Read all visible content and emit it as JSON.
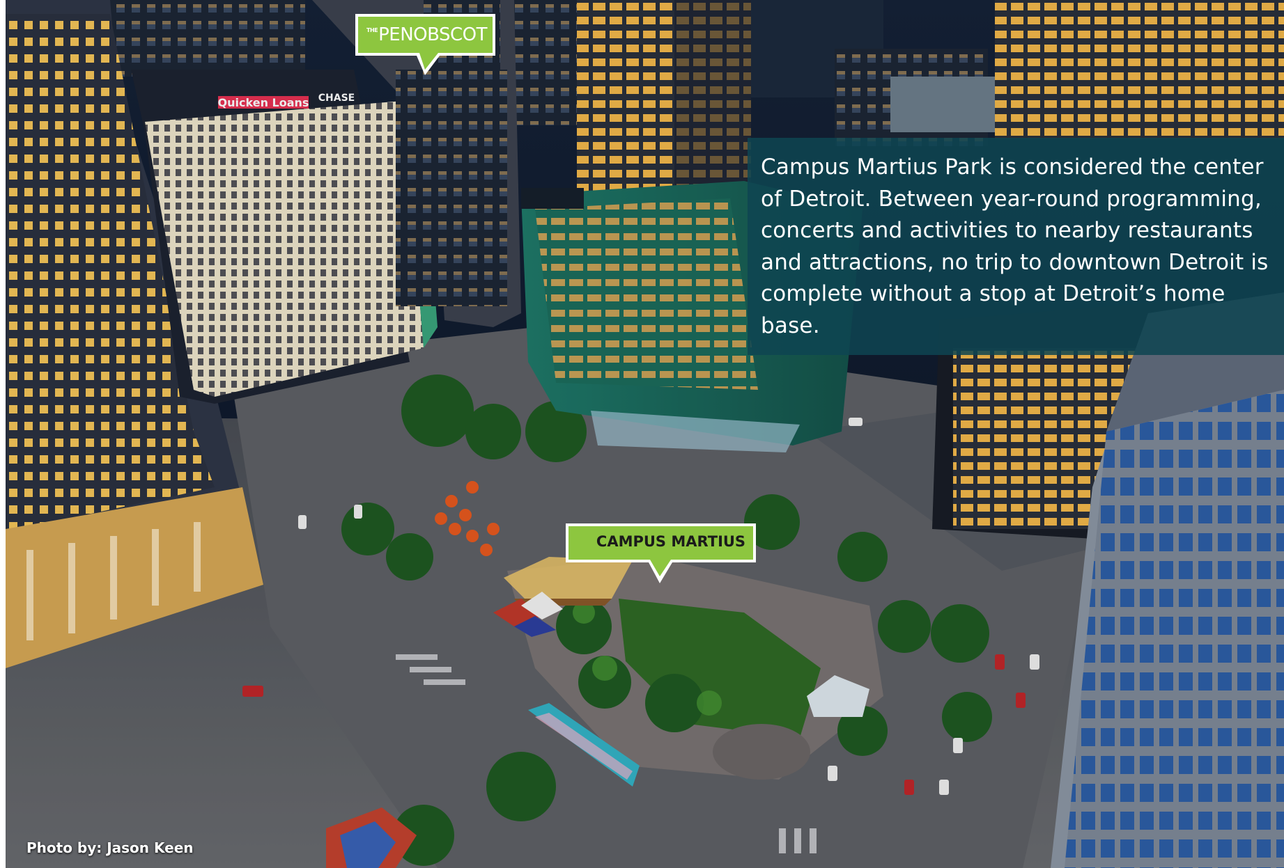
{
  "labels": {
    "penobscot": {
      "prefix": "THE",
      "name": "PENOBSCOT"
    },
    "campus_martius": {
      "name": "CAMPUS MARTIUS"
    }
  },
  "callout": {
    "text": "Campus Martius Park is considered the center of Detroit. Between year-round programming, concerts and activities to nearby restaurants and attractions, no trip to downtown Detroit is complete without a stop at Detroit’s home base."
  },
  "photo_credit": "Photo by: Jason Keen",
  "signage": {
    "quicken": "Quicken Loans",
    "chase": "CHASE"
  },
  "colors": {
    "label_green": "#8dc63f",
    "label_border": "#ffffff",
    "callout_bg": "#0e4552",
    "sky_night": "#0d1a2b",
    "park_lawn": "#2f6a25",
    "quicken_red": "#ff3358"
  }
}
